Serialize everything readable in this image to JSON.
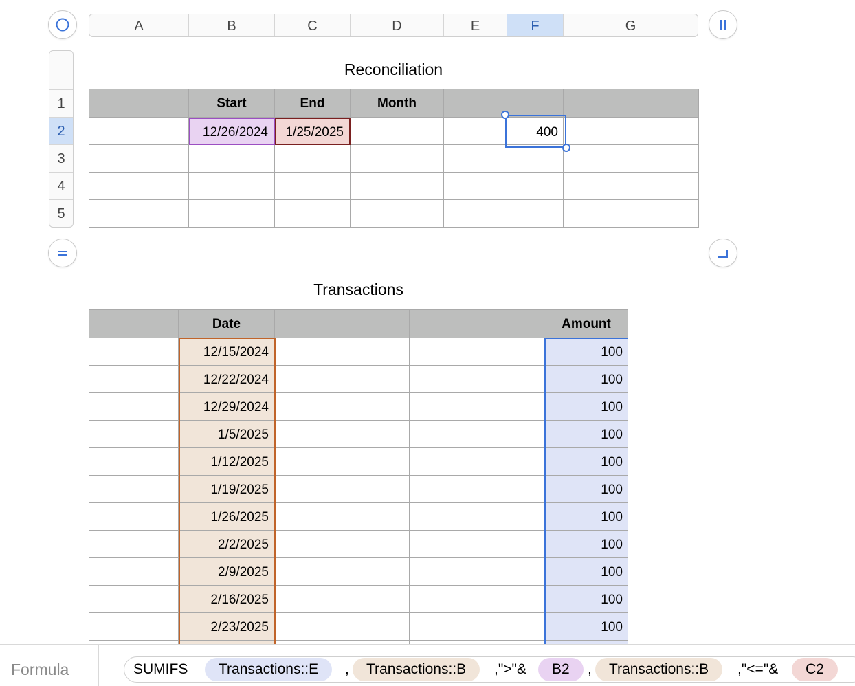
{
  "columns": [
    "A",
    "B",
    "C",
    "D",
    "E",
    "F",
    "G"
  ],
  "selected_column": "F",
  "rows": [
    "1",
    "2",
    "3",
    "4",
    "5"
  ],
  "selected_row": "2",
  "reconciliation": {
    "title": "Reconciliation",
    "headers": [
      "",
      "Start",
      "End",
      "Month",
      "",
      "",
      ""
    ],
    "row2": {
      "start": "12/26/2024",
      "end": "1/25/2025",
      "result": "400"
    }
  },
  "transactions": {
    "title": "Transactions",
    "headers": [
      "",
      "Date",
      "",
      "",
      "Amount"
    ],
    "rows": [
      {
        "date": "12/15/2024",
        "amount": "100"
      },
      {
        "date": "12/22/2024",
        "amount": "100"
      },
      {
        "date": "12/29/2024",
        "amount": "100"
      },
      {
        "date": "1/5/2025",
        "amount": "100"
      },
      {
        "date": "1/12/2025",
        "amount": "100"
      },
      {
        "date": "1/19/2025",
        "amount": "100"
      },
      {
        "date": "1/26/2025",
        "amount": "100"
      },
      {
        "date": "2/2/2025",
        "amount": "100"
      },
      {
        "date": "2/9/2025",
        "amount": "100"
      },
      {
        "date": "2/16/2025",
        "amount": "100"
      },
      {
        "date": "2/23/2025",
        "amount": "100"
      }
    ]
  },
  "formula_bar": {
    "label": "Formula",
    "function": "SUMIFS",
    "tokens": [
      "Transactions::E",
      ",",
      "Transactions::B",
      ",\">\"&",
      "B2",
      ",",
      "Transactions::B",
      ",\"<=\"&",
      "C2"
    ]
  },
  "colors": {
    "accent_blue": "#3b73d9",
    "start_ref": "#e9d3f2",
    "end_ref": "#f3d7d5",
    "date_ref": "#f1e5d9",
    "amount_ref": "#dfe4f7"
  }
}
